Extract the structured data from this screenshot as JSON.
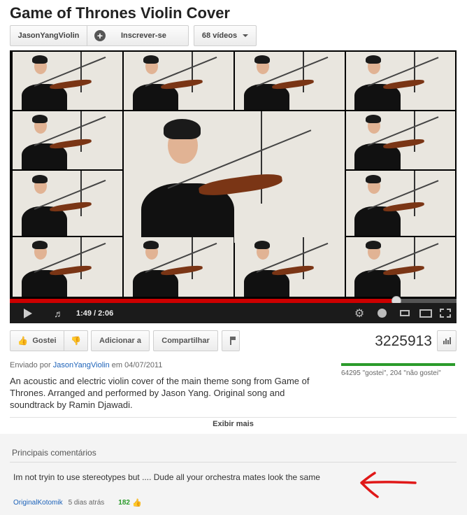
{
  "video": {
    "title": "Game of Thrones Violin Cover"
  },
  "channel": {
    "name": "JasonYangViolin",
    "subscribe_label": "Inscrever-se",
    "videos_label": "68 vídeos"
  },
  "player": {
    "time": "1:49 / 2:06",
    "progress_fraction": 0.865
  },
  "actions": {
    "like_label": "Gostei",
    "add_label": "Adicionar a",
    "share_label": "Compartilhar"
  },
  "stats": {
    "views": "3225913",
    "ratio_text": "64295 \"gostei\", 204 \"não gostei\"",
    "like_fraction": 0.997
  },
  "upload": {
    "prefix": "Enviado por",
    "author": "JasonYangViolin",
    "date_text": "em 04/07/2011"
  },
  "description": "An acoustic and electric violin cover of the main theme song from Game of Thrones. Arranged and performed by Jason Yang. Original song and soundtrack by Ramin Djawadi.",
  "show_more": "Exibir mais",
  "comments": {
    "header": "Principais comentários",
    "items": [
      {
        "text": "Im not tryin to use stereotypes but .... Dude all your orchestra mates look the same",
        "author": "OriginalKotomik",
        "age": "5 dias atrás",
        "likes": "182"
      }
    ]
  },
  "annotation": {
    "arrow_color": "#e01818"
  },
  "colors": {
    "link": "#1c62b9",
    "progress": "#cc0000",
    "like_green": "#2b9b2b"
  }
}
